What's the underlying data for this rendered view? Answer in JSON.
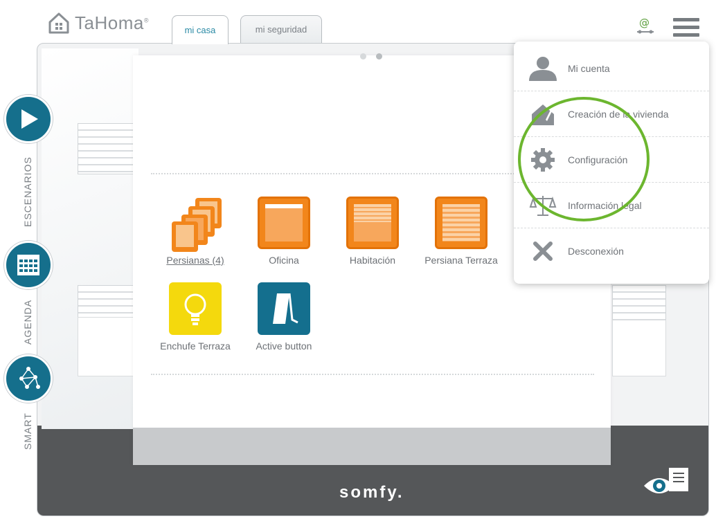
{
  "app": {
    "logo_text": "TaHoma",
    "logo_reg": "®"
  },
  "tabs": [
    {
      "label": "mi casa",
      "active": true
    },
    {
      "label": "mi seguridad",
      "active": false
    }
  ],
  "header_icons": {
    "internet": "at-sign-icon",
    "menu": "hamburger-menu-icon"
  },
  "side_nav": [
    {
      "label": "ESCENARIOS",
      "icon": "play-icon"
    },
    {
      "label": "AGENDA",
      "icon": "calendar-icon"
    },
    {
      "label": "SMART",
      "icon": "network-icon"
    }
  ],
  "devices": [
    {
      "label": "Persianas (4)",
      "type": "orange-group",
      "link": true
    },
    {
      "label": "Oficina",
      "type": "orange-blind"
    },
    {
      "label": "Habitación",
      "type": "orange-shutter"
    },
    {
      "label": "Persiana Terraza",
      "type": "orange-slats"
    },
    {
      "label": "Enchufe Terraza",
      "type": "yellow-bulb"
    },
    {
      "label": "Active button",
      "type": "teal-switch"
    }
  ],
  "menu": {
    "items": [
      {
        "label": "Mi cuenta",
        "icon": "user-icon"
      },
      {
        "label": "Creación de la vivienda",
        "icon": "house-icon"
      },
      {
        "label": "Configuración",
        "icon": "gear-icon"
      },
      {
        "label": "Información legal",
        "icon": "scales-icon"
      },
      {
        "label": "Desconexión",
        "icon": "close-icon"
      }
    ]
  },
  "brand": {
    "footer": "somfy."
  },
  "colors": {
    "accent": "#156f8c",
    "orange": "#f2861b",
    "yellow": "#f4d90d",
    "highlight": "#6cb62f",
    "footer": "#555759"
  }
}
